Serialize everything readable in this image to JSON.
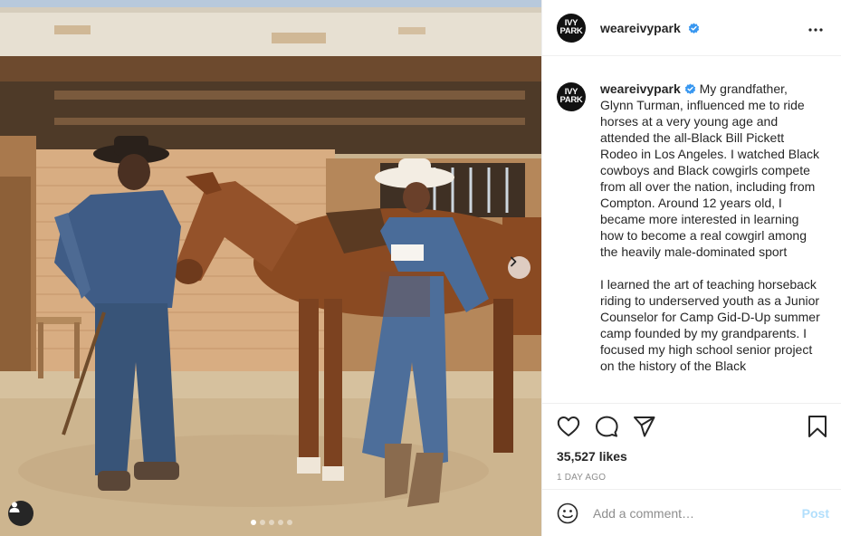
{
  "post": {
    "username": "weareivypark",
    "avatar_text_line1": "IVY",
    "avatar_text_line2": "PARK",
    "verified_icon": "verified-badge-icon",
    "more_icon": "more-options-icon",
    "caption_paragraph_1": "My grandfather, Glynn Turman, influenced me to ride horses at a very young age and attended the all-Black Bill Pickett Rodeo in Los Angeles. I watched Black cowboys and Black cowgirls compete from all over the nation, including from Compton. Around 12 years old, I became more interested in learning how to become a real cowgirl among the heavily male-dominated sport",
    "caption_paragraph_2": "I learned the art of teaching horseback riding to underserved youth as a Junior Counselor for Camp Gid-D-Up summer camp founded by my grandparents. I focused my high school senior project on the history of the Black",
    "likes": "35,527 likes",
    "time_ago": "1 DAY AGO"
  },
  "carousel": {
    "slide_count": 5,
    "active_index": 0
  },
  "comment": {
    "placeholder": "Add a comment…",
    "post_label": "Post"
  },
  "colors": {
    "verified": "#3897f0",
    "post_disabled": "#b2dffc",
    "muted_text": "#8e8e8e",
    "border": "#efefef"
  }
}
